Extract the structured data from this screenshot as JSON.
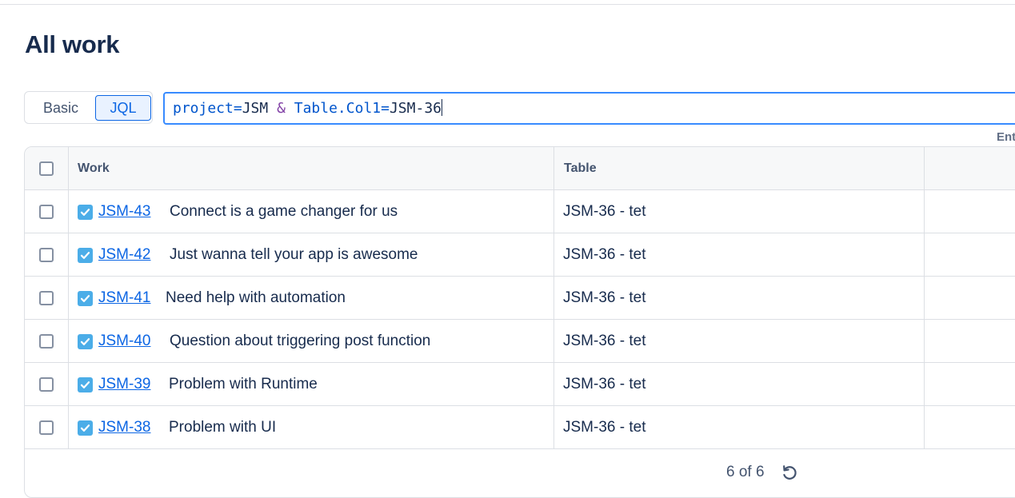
{
  "page": {
    "title": "All work"
  },
  "search": {
    "modes": {
      "basic": "Basic",
      "jql": "JQL",
      "active": "JQL"
    },
    "query_tokens": {
      "f1": "project",
      "op1": "=",
      "v1": "JSM",
      "kw": "&",
      "f2": "Table.Col1",
      "op2": "=",
      "v2": "JSM-36"
    },
    "query": "project=JSM & Table.Col1=JSM-36",
    "hint": "Ent"
  },
  "table": {
    "columns": [
      "Work",
      "Table",
      ""
    ],
    "rows": [
      {
        "key": "JSM-43",
        "summary": "Connect is a game changer for us",
        "table": "JSM-36 - tet",
        "type_icon": "checkbox-icon"
      },
      {
        "key": "JSM-42",
        "summary": "Just wanna tell your app is awesome",
        "table": "JSM-36 - tet",
        "type_icon": "checkbox-icon"
      },
      {
        "key": "JSM-41",
        "summary": "Need help with automation",
        "table": "JSM-36 - tet",
        "type_icon": "checkbox-icon"
      },
      {
        "key": "JSM-40",
        "summary": "Question about triggering post function",
        "table": "JSM-36 - tet",
        "type_icon": "checkbox-icon"
      },
      {
        "key": "JSM-39",
        "summary": "Problem with Runtime",
        "table": "JSM-36 - tet",
        "type_icon": "checkbox-icon"
      },
      {
        "key": "JSM-38",
        "summary": "Problem with UI",
        "table": "JSM-36 - tet",
        "type_icon": "checkbox-icon"
      }
    ],
    "footer": {
      "count": "6 of 6",
      "refresh_icon": "refresh-icon"
    }
  },
  "colors": {
    "accent": "#0c66e4",
    "work_type_icon": "#4bade8",
    "focus_border": "#388bff"
  }
}
